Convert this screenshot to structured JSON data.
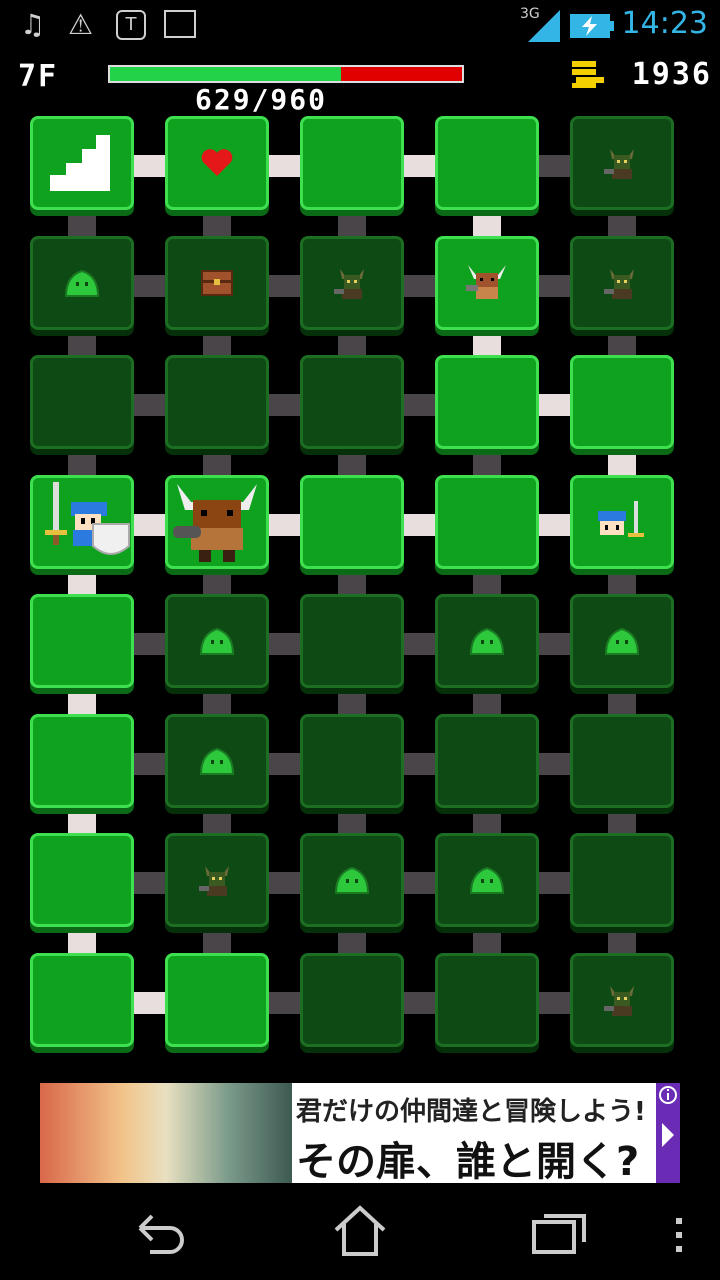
{
  "status_bar": {
    "time": "14:23",
    "network": "3G",
    "icons": [
      "music-icon",
      "warning-icon",
      "shield-app-icon",
      "image-icon",
      "signal-icon",
      "battery-icon"
    ]
  },
  "hud": {
    "floor": "7F",
    "hp_text": "629/960",
    "hp_current": 629,
    "hp_max": 960,
    "gold": "1936"
  },
  "board": {
    "cols": 5,
    "rows": 8,
    "tiles": [
      [
        "stairs",
        "heart",
        "empty",
        "empty",
        "goblin"
      ],
      [
        "slime",
        "chest",
        "goblin",
        "minotaur",
        "goblin"
      ],
      [
        "dark",
        "dark",
        "dark",
        "empty",
        "empty"
      ],
      [
        "hero",
        "minotaur-big",
        "empty",
        "empty",
        "hero-small"
      ],
      [
        "empty",
        "slime",
        "dark",
        "slime",
        "slime"
      ],
      [
        "empty",
        "slime",
        "dark",
        "dark",
        "dark"
      ],
      [
        "empty",
        "goblin",
        "slime",
        "slime",
        "dark"
      ],
      [
        "empty",
        "empty",
        "dark",
        "dark",
        "goblin"
      ]
    ],
    "lit": [
      [
        1,
        1,
        1,
        1,
        0
      ],
      [
        0,
        0,
        0,
        1,
        0
      ],
      [
        0,
        0,
        0,
        1,
        1
      ],
      [
        1,
        1,
        1,
        1,
        1
      ],
      [
        1,
        0,
        0,
        0,
        0
      ],
      [
        1,
        0,
        0,
        0,
        0
      ],
      [
        1,
        0,
        0,
        0,
        0
      ],
      [
        1,
        1,
        0,
        0,
        0
      ]
    ],
    "h_conn": [
      [
        1,
        1,
        1,
        0
      ],
      [
        0,
        0,
        0,
        0
      ],
      [
        0,
        0,
        0,
        1
      ],
      [
        1,
        1,
        1,
        1
      ],
      [
        0,
        0,
        0,
        0
      ],
      [
        0,
        0,
        0,
        0
      ],
      [
        0,
        0,
        0,
        0
      ],
      [
        1,
        0,
        0,
        0
      ]
    ],
    "v_conn": [
      [
        0,
        0,
        0,
        1,
        0
      ],
      [
        0,
        0,
        0,
        1,
        0
      ],
      [
        0,
        0,
        0,
        0,
        1
      ],
      [
        1,
        0,
        0,
        0,
        0
      ],
      [
        1,
        0,
        0,
        0,
        0
      ],
      [
        1,
        0,
        0,
        0,
        0
      ],
      [
        1,
        0,
        0,
        0,
        0
      ]
    ]
  },
  "ad": {
    "line1": "君だけの仲間達と冒険しよう!",
    "line2": "その扉、誰と開く?"
  },
  "navbar": {
    "buttons": [
      "back-icon",
      "home-icon",
      "recents-icon",
      "menu-icon"
    ]
  }
}
